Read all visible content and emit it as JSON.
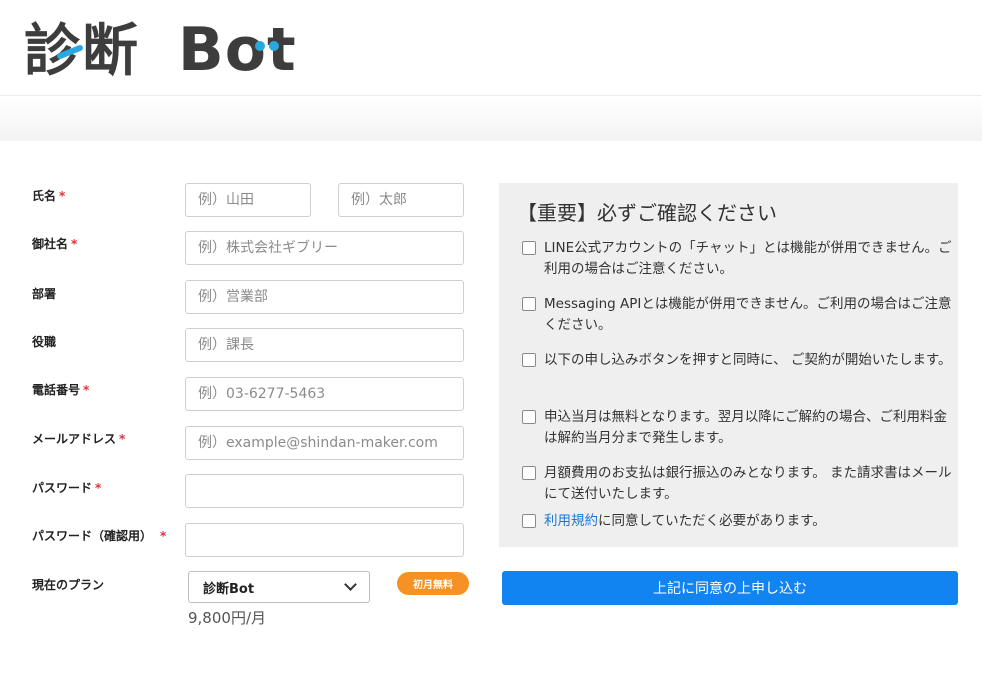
{
  "logo": {
    "text_kanji": "診断",
    "text_latin": "Bot"
  },
  "form": {
    "name_label": "氏名",
    "required_mark": "*",
    "last_name_placeholder": "例）山田",
    "first_name_placeholder": "例）太郎",
    "company_label": "御社名",
    "company_placeholder": "例）株式会社ギブリー",
    "department_label": "部署",
    "department_placeholder": "例）営業部",
    "position_label": "役職",
    "position_placeholder": "例）課長",
    "phone_label": "電話番号",
    "phone_placeholder": "例）03-6277-5463",
    "email_label": "メールアドレス",
    "email_placeholder": "例）example@shindan-maker.com",
    "password_label": "パスワード",
    "password_confirm_label": "パスワード（確認用）",
    "plan_label": "現在のプラン",
    "plan_selected": "診断Bot",
    "badge": "初月無料",
    "price": "9,800円/月"
  },
  "notice": {
    "title": "【重要】必ずご確認ください",
    "items": [
      "LINE公式アカウントの「チャット」とは機能が併用できません。ご利用の場合はご注意ください。",
      "Messaging APIとは機能が併用できません。ご利用の場合はご注意ください。",
      "以下の申し込みボタンを押すと同時に、 ご契約が開始いたします。",
      "申込当月は無料となります。翌月以降にご解約の場合、ご利用料金は解約当月分まで発生します。",
      "月額費用のお支払は銀行振込のみとなります。 また請求書はメールにて送付いたします。"
    ],
    "terms_link": "利用規約",
    "terms_text": "に同意していただく必要があります。"
  },
  "submit_label": "上記に同意の上申し込む",
  "colors": {
    "accent_blue": "#1284f2",
    "badge_orange": "#f59223",
    "required_red": "#e0303a"
  }
}
